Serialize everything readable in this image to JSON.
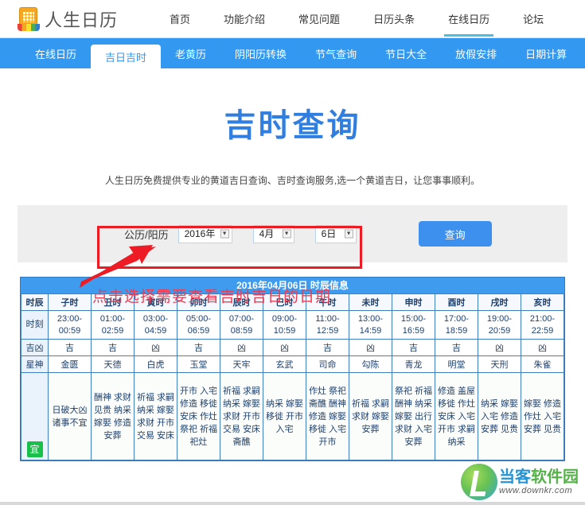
{
  "site": {
    "logo_text": "人生日历",
    "logo_icon": "calendar-icon"
  },
  "topnav": {
    "items": [
      {
        "label": "首页",
        "active": false
      },
      {
        "label": "功能介绍",
        "active": false
      },
      {
        "label": "常见问题",
        "active": false
      },
      {
        "label": "日历头条",
        "active": false
      },
      {
        "label": "在线日历",
        "active": true
      },
      {
        "label": "论坛",
        "active": false
      }
    ],
    "active_underline_color": "#4ac0e0"
  },
  "subnav": {
    "background": "#3399f0",
    "items": [
      {
        "label": "在线日历",
        "active": false
      },
      {
        "label": "吉日吉时",
        "active": true
      },
      {
        "label": "老黄历",
        "active": false
      },
      {
        "label": "阴阳历转换",
        "active": false
      },
      {
        "label": "节气查询",
        "active": false
      },
      {
        "label": "节日大全",
        "active": false
      },
      {
        "label": "放假安排",
        "active": false
      },
      {
        "label": "日期计算",
        "active": false
      }
    ]
  },
  "hero": {
    "title": "吉时查询",
    "title_color": "#2f7ee0",
    "description": "人生日历免费提供专业的黄道吉日查询、吉时查询服务,选一个黄道吉日，让您事事顺利。"
  },
  "form": {
    "calendar_label": "公历/阳历",
    "year_value": "2016年",
    "month_value": "4月",
    "day_value": "6日",
    "dropdown_arrow": "chevron-down-icon",
    "submit_label": "查询",
    "submit_color": "#3d90ee"
  },
  "annotation": {
    "text": "点击选择需要查看吉时吉日的日期",
    "color": "#ef3b52",
    "box_color": "#ed1c24",
    "arrow_icon": "arrow-pointer-icon"
  },
  "table": {
    "title": "2016年04月06日 时辰信息",
    "row_labels": {
      "shichen": "时辰",
      "shike": "时刻",
      "jixiong": "吉凶",
      "xingshen": "星神",
      "yi": "宜"
    },
    "shichen": [
      "子时",
      "丑时",
      "寅时",
      "卯时",
      "辰时",
      "巳时",
      "午时",
      "未时",
      "申时",
      "酉时",
      "戌时",
      "亥时"
    ],
    "shike_start": [
      "23:00-",
      "01:00-",
      "03:00-",
      "05:00-",
      "07:00-",
      "09:00-",
      "11:00-",
      "13:00-",
      "15:00-",
      "17:00-",
      "19:00-",
      "21:00-"
    ],
    "shike_end": [
      "00:59",
      "02:59",
      "04:59",
      "06:59",
      "08:59",
      "10:59",
      "12:59",
      "14:59",
      "16:59",
      "18:59",
      "20:59",
      "22:59"
    ],
    "jixiong": [
      "吉",
      "吉",
      "凶",
      "吉",
      "凶",
      "凶",
      "吉",
      "凶",
      "吉",
      "吉",
      "凶",
      "凶"
    ],
    "xingshen": [
      "金匮",
      "天德",
      "白虎",
      "玉堂",
      "天牢",
      "玄武",
      "司命",
      "勾陈",
      "青龙",
      "明堂",
      "天刑",
      "朱雀"
    ],
    "yi": [
      "日破大凶 诸事不宜",
      "酬神 求财 见贵 纳采 嫁娶 修造 安葬",
      "祈福 求嗣 纳采 嫁娶 求财 开市 交易 安床",
      "开市 入宅 修造 移徙 安床 作灶 祭祀 祈福 祀灶",
      "祈福 求嗣 纳采 嫁娶 求财 开市 交易 安床 斋醮",
      "纳采 嫁娶 移徙 开市 入宅",
      "作灶 祭祀 斋醮 酬神 修造 嫁娶 移徙 入宅 开市",
      "祈福 求嗣 求财 嫁娶 安葬",
      "祭祀 祈福 酬神 纳采 嫁娶 出行 求财 入宅 安葬",
      "修造 盖屋 移徙 作灶 安床 入宅 开市 求嗣 纳采",
      "纳采 嫁娶 入宅 修造 安葬 见贵",
      "嫁娶 修造 作灶 入宅 安葬 见贵"
    ]
  },
  "watermark": {
    "title_part1": "当客",
    "title_part2": "软件园",
    "url": "www.downkr.com",
    "logo_icon": "downkr-logo-icon"
  }
}
